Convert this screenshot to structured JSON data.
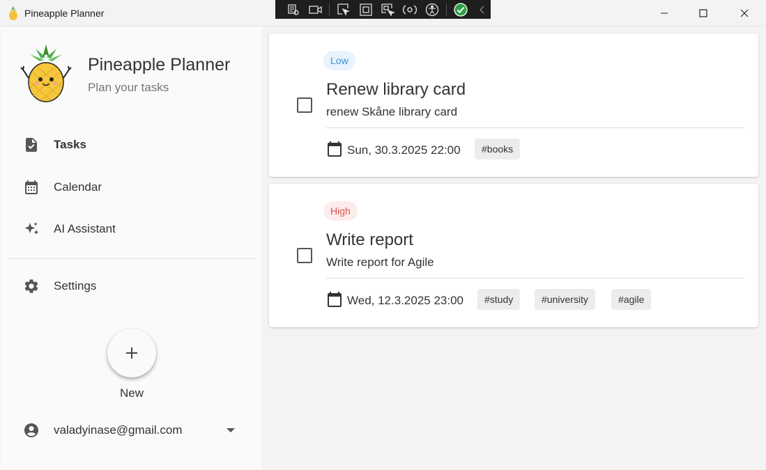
{
  "window": {
    "title": "Pineapple Planner",
    "icons": [
      "pineapple-icon",
      "minimize-icon",
      "maximize-icon",
      "close-icon"
    ]
  },
  "debug_toolbar": {
    "icons": [
      "live-visual-tree-icon",
      "record-icon",
      "select-element-icon",
      "display-layout-adorners-icon",
      "track-focus-icon",
      "hot-reload-icon",
      "accessibility-icon",
      "checked-status-icon",
      "collapse-icon"
    ]
  },
  "sidebar": {
    "brand_title": "Pineapple Planner",
    "brand_subtitle": "Plan your tasks",
    "nav": [
      {
        "label": "Tasks",
        "icon": "task-document-icon",
        "active": true
      },
      {
        "label": "Calendar",
        "icon": "calendar-icon",
        "active": false
      },
      {
        "label": "AI Assistant",
        "icon": "sparkle-icon",
        "active": false
      },
      {
        "label": "Settings",
        "icon": "gear-icon",
        "active": false
      }
    ],
    "new_button_label": "New",
    "account_email": "valadyinase@gmail.com"
  },
  "tasks": [
    {
      "priority": "Low",
      "title": "Renew library card",
      "description": "renew Skåne library card",
      "date": "Sun, 30.3.2025 22:00",
      "tags": [
        "#books"
      ],
      "completed": false
    },
    {
      "priority": "High",
      "title": "Write report",
      "description": "Write report for Agile",
      "date": "Wed, 12.3.2025 23:00",
      "tags": [
        "#study",
        "#university",
        "#agile"
      ],
      "completed": false
    }
  ],
  "colors": {
    "priority_low_bg": "#e8f3fd",
    "priority_low_text": "#3c8fd6",
    "priority_high_bg": "#fdecec",
    "priority_high_text": "#d9534f",
    "tag_bg": "#ececec"
  }
}
